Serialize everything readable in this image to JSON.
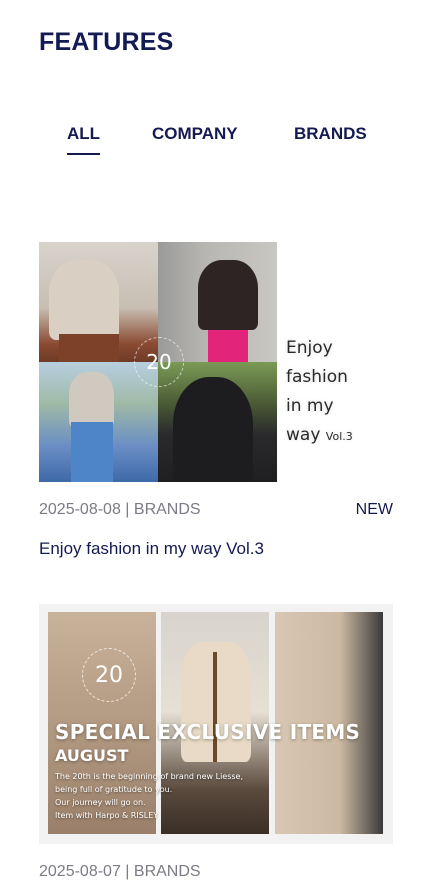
{
  "header": {
    "title": "FEATURES"
  },
  "tabs": [
    {
      "label": "ALL",
      "active": true
    },
    {
      "label": "COMPANY",
      "active": false
    },
    {
      "label": "BRANDS",
      "active": false
    }
  ],
  "articles": [
    {
      "image": {
        "badge_number": "20",
        "caption_main_line1": "Enjoy fashion",
        "caption_main_line2": "in my way",
        "caption_vol": "Vol.3"
      },
      "date": "2025-08-08",
      "separator": "|",
      "category": "BRANDS",
      "badge": "NEW",
      "title": "Enjoy fashion in my way Vol.3"
    },
    {
      "image": {
        "badge_number": "20",
        "headline": "SPECIAL EXCLUSIVE ITEMS",
        "subheadline": "AUGUST",
        "body_lines": [
          "The 20th is the beginning of brand new Liesse,",
          "being full of gratitude to you.",
          "Our journey will go on.",
          "Item with Harpo & RISLEY"
        ]
      },
      "date": "2025-08-07",
      "separator": "|",
      "category": "BRANDS"
    }
  ],
  "colors": {
    "primary": "#141a52",
    "meta_text": "#7b7b87",
    "background": "#ffffff"
  }
}
